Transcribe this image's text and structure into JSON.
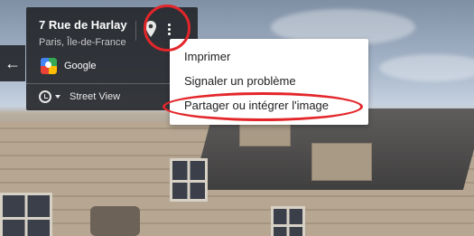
{
  "card": {
    "title": "7 Rue de Harlay",
    "subtitle": "Paris, Île-de-France",
    "provider_label": "Google",
    "mode_label": "Street View"
  },
  "menu": {
    "items": [
      {
        "label": "Imprimer"
      },
      {
        "label": "Signaler un problème"
      },
      {
        "label": "Partager ou intégrer l'image"
      }
    ]
  },
  "icons": {
    "back": "arrow-left-icon",
    "pin": "map-pin-icon",
    "more": "more-vert-icon",
    "provider": "google-maps-icon",
    "history": "history-icon",
    "caret": "caret-down-icon"
  },
  "colors": {
    "card_bg": "#202124",
    "annotation": "#e3262a",
    "menu_text": "#202124"
  },
  "back_glyph": "←"
}
